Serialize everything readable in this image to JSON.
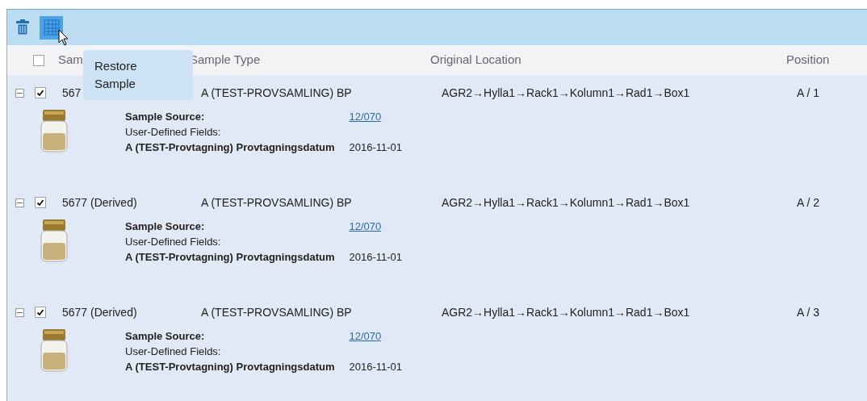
{
  "toolbar": {
    "tooltip": {
      "lines": [
        "Restore",
        "Sample"
      ]
    }
  },
  "header": {
    "checked": false,
    "columns": [
      "Sam",
      "Sample Type",
      "Original Location",
      "Position"
    ]
  },
  "rows": [
    {
      "expanded": true,
      "checked": true,
      "name": "567",
      "type": "A (TEST-PROVSAMLING) BP",
      "location": "AGR2→Hylla1→Rack1→Kolumn1→Rad1→Box1",
      "position": "A / 1",
      "source_label": "Sample Source:",
      "source": "12/070",
      "udf_label": "User-Defined Fields:",
      "field_label": "A (TEST-Provtagning) Provtagningsdatum",
      "field_value": "2016-11-01"
    },
    {
      "expanded": true,
      "checked": true,
      "name": "5677 (Derived)",
      "type": "A (TEST-PROVSAMLING) BP",
      "location": "AGR2→Hylla1→Rack1→Kolumn1→Rad1→Box1",
      "position": "A / 2",
      "source_label": "Sample Source:",
      "source": "12/070",
      "udf_label": "User-Defined Fields:",
      "field_label": "A (TEST-Provtagning) Provtagningsdatum",
      "field_value": "2016-11-01"
    },
    {
      "expanded": true,
      "checked": true,
      "name": "5677 (Derived)",
      "type": "A (TEST-PROVSAMLING) BP",
      "location": "AGR2→Hylla1→Rack1→Kolumn1→Rad1→Box1",
      "position": "A / 3",
      "source_label": "Sample Source:",
      "source": "12/070",
      "udf_label": "User-Defined Fields:",
      "field_label": "A (TEST-Provtagning) Provtagningsdatum",
      "field_value": "2016-11-01"
    }
  ]
}
